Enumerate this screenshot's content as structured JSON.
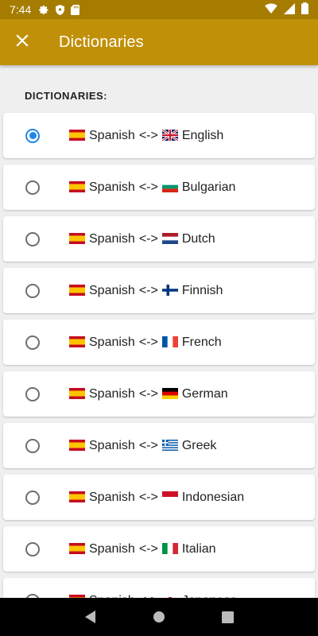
{
  "status_bar": {
    "time": "7:44",
    "icons_left": [
      "gear-icon",
      "shield-icon",
      "sd-card-icon"
    ],
    "icons_right": [
      "wifi-icon",
      "signal-icon",
      "battery-icon"
    ]
  },
  "app_bar": {
    "title": "Dictionaries",
    "close_icon": "close-icon",
    "color": "#c09008"
  },
  "section_header": "DICTIONARIES:",
  "dictionaries": [
    {
      "from": "Spanish",
      "separator": "<->",
      "to": "English",
      "from_flag": "es",
      "to_flag": "gb",
      "selected": true
    },
    {
      "from": "Spanish",
      "separator": "<->",
      "to": "Bulgarian",
      "from_flag": "es",
      "to_flag": "bg",
      "selected": false
    },
    {
      "from": "Spanish",
      "separator": "<->",
      "to": "Dutch",
      "from_flag": "es",
      "to_flag": "nl",
      "selected": false
    },
    {
      "from": "Spanish",
      "separator": "<->",
      "to": "Finnish",
      "from_flag": "es",
      "to_flag": "fi",
      "selected": false
    },
    {
      "from": "Spanish",
      "separator": "<->",
      "to": "French",
      "from_flag": "es",
      "to_flag": "fr",
      "selected": false
    },
    {
      "from": "Spanish",
      "separator": "<->",
      "to": "German",
      "from_flag": "es",
      "to_flag": "de",
      "selected": false
    },
    {
      "from": "Spanish",
      "separator": "<->",
      "to": "Greek",
      "from_flag": "es",
      "to_flag": "gr",
      "selected": false
    },
    {
      "from": "Spanish",
      "separator": "<->",
      "to": "Indonesian",
      "from_flag": "es",
      "to_flag": "id",
      "selected": false
    },
    {
      "from": "Spanish",
      "separator": "<->",
      "to": "Italian",
      "from_flag": "es",
      "to_flag": "it",
      "selected": false
    },
    {
      "from": "Spanish",
      "separator": "<->",
      "to": "Japanese",
      "from_flag": "es",
      "to_flag": "jp",
      "selected": false
    }
  ],
  "nav_bar": {
    "icons": [
      "back-icon",
      "home-icon",
      "recents-icon"
    ]
  },
  "colors": {
    "status_bar": "#a67c00",
    "accent": "#1e88e5",
    "background": "#efefef"
  }
}
